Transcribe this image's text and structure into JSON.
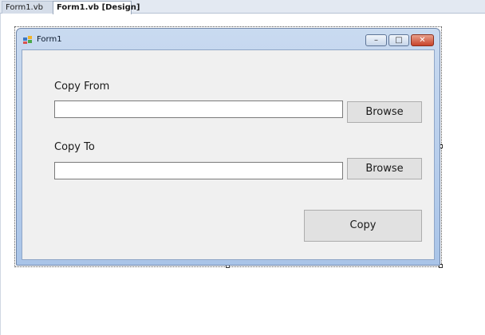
{
  "tabs": [
    {
      "label": "Form1.vb",
      "active": false
    },
    {
      "label": "Form1.vb [Design]",
      "active": true
    }
  ],
  "form": {
    "title": "Form1",
    "icon": "windows-form-icon",
    "caption_buttons": {
      "minimize_glyph": "–",
      "maximize_glyph": "□",
      "close_glyph": "✕"
    },
    "copy_from_label": "Copy From",
    "copy_from_value": "",
    "copy_to_label": "Copy To",
    "copy_to_value": "",
    "browse_label_1": "Browse",
    "browse_label_2": "Browse",
    "copy_label": "Copy"
  },
  "colors": {
    "titlebar_top": "#c9daf0",
    "titlebar_bottom": "#a9c4e8",
    "client_bg": "#f0f0f0",
    "button_bg": "#e1e1e1",
    "close_button": "#c8432a"
  }
}
